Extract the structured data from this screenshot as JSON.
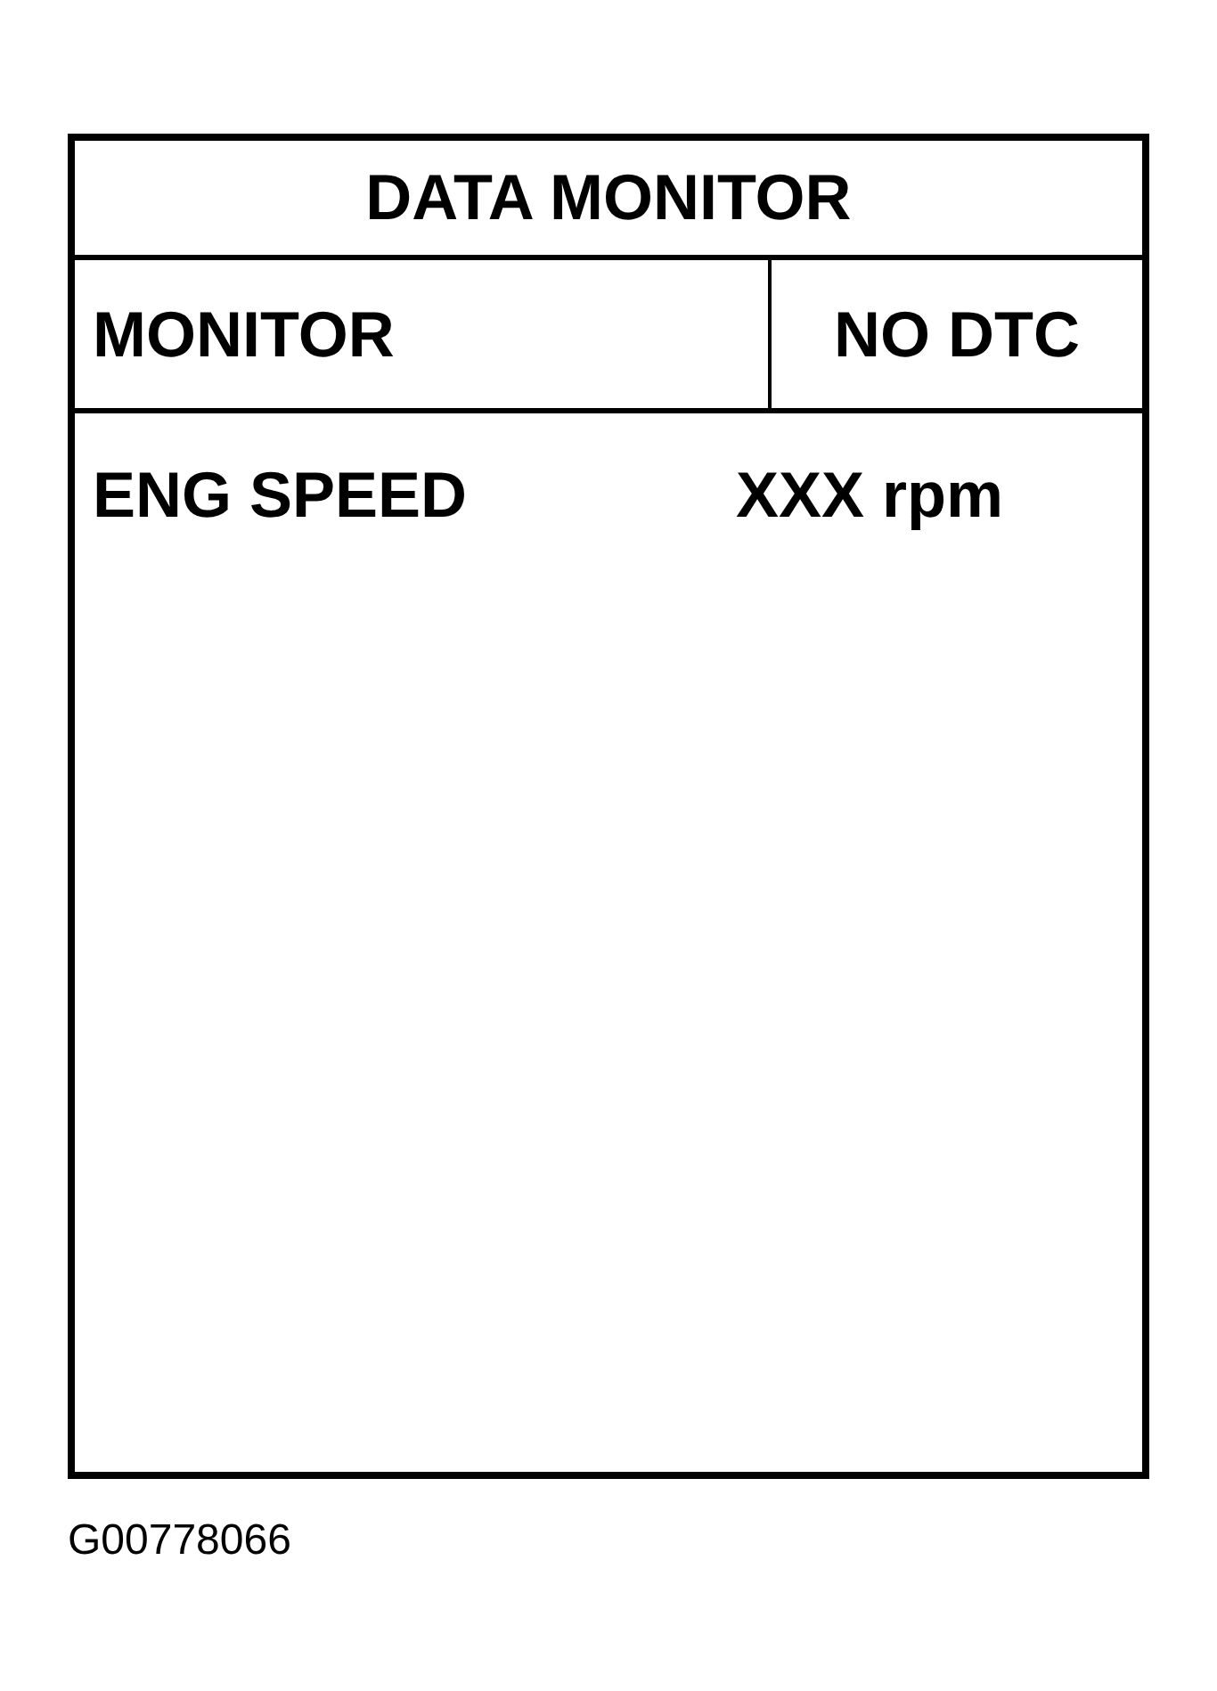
{
  "title": "DATA MONITOR",
  "header": {
    "mode": "MONITOR",
    "status": "NO DTC"
  },
  "rows": [
    {
      "label": "ENG SPEED",
      "value": "XXX rpm"
    }
  ],
  "figure_id": "G00778066"
}
